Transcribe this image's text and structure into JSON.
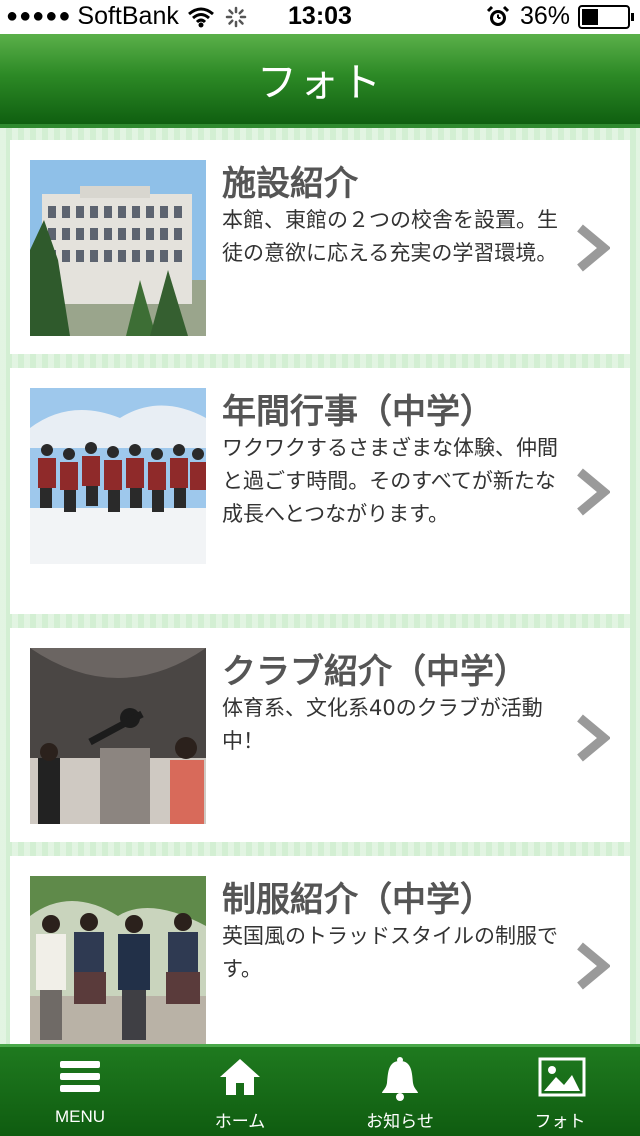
{
  "status_bar": {
    "carrier": "SoftBank",
    "time": "13:03",
    "battery": "36%",
    "battery_level": 0.36
  },
  "header": {
    "title": "フォト"
  },
  "cards": [
    {
      "title": "施設紹介",
      "description": "本館、東館の２つの校舎を設置。生徒の意欲に応える充実の学習環境。"
    },
    {
      "title": "年間行事（中学）",
      "description": "ワクワクするさまざまな体験、仲間と過ごす時間。そのすべてが新たな成長へとつながります。"
    },
    {
      "title": "クラブ紹介（中学）",
      "description": "体育系、文化系40のクラブが活動中！"
    },
    {
      "title": "制服紹介（中学）",
      "description": "英国風のトラッドスタイルの制服です。"
    }
  ],
  "tabbar": {
    "items": [
      {
        "label": "MENU",
        "icon": "menu-icon"
      },
      {
        "label": "ホーム",
        "icon": "home-icon"
      },
      {
        "label": "お知らせ",
        "icon": "bell-icon"
      },
      {
        "label": "フォト",
        "icon": "photo-icon"
      }
    ]
  },
  "colors": {
    "header_green": "#2d8a26",
    "accent_light": "#d3efd3",
    "chevron": "#9a9a9a"
  }
}
